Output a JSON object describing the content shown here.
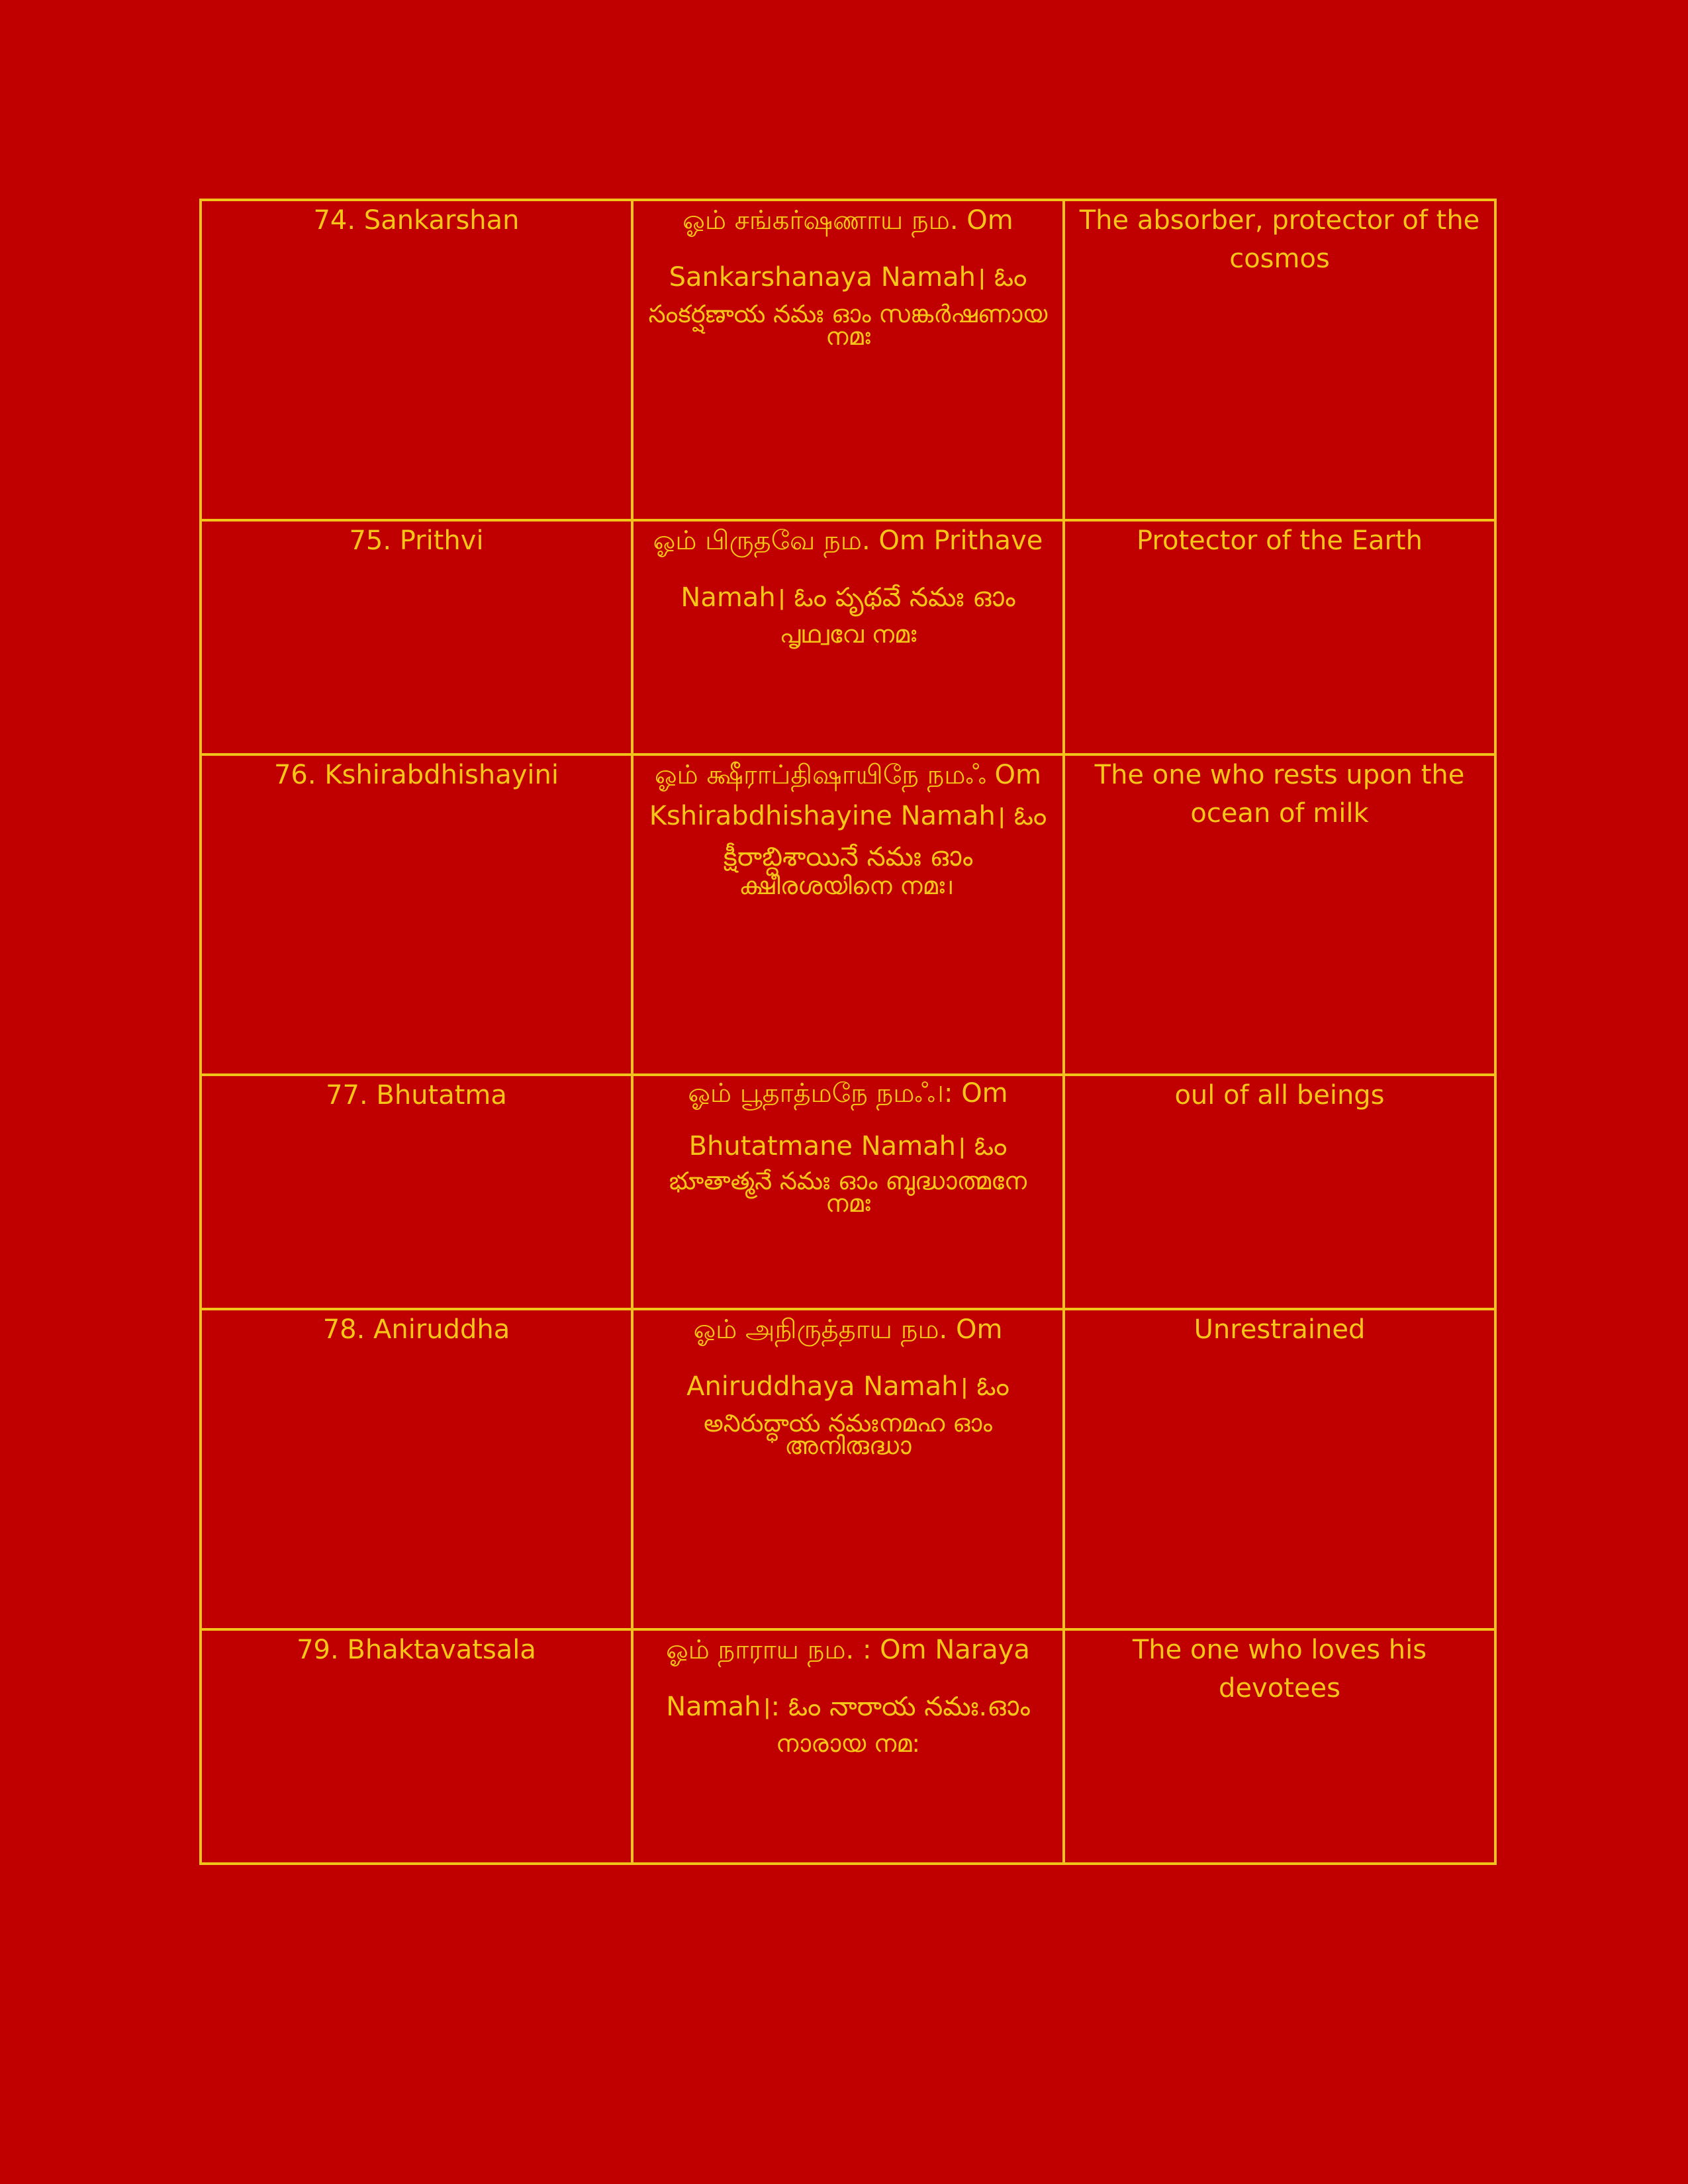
{
  "page": {
    "background_color": "#c00000",
    "text_color": "#f5c518",
    "border_color": "#f0c419"
  },
  "rows": [
    {
      "name": "74. Sankarshan",
      "mantra_head": "ஓம் சங்கர்ஷணாய நம.  Om Sankarshanaya Namah।  ఓం",
      "mantra_tail": "సంకర్షణాయ నమః ഓം സങ്കർഷണായ നമഃ",
      "meaning": "The absorber, protector of the cosmos"
    },
    {
      "name": "75. Prithvi",
      "mantra_head": "ஓம் பிருதவே நம.  Om Prithave Namah।  ఓం పృథవే నమః ഓം",
      "mantra_tail": "പൃഥ്വവേ നമഃ",
      "meaning": "Protector of the Earth"
    },
    {
      "name": "76. Kshirabdhishayini",
      "mantra_head": "ஓம் க்ஷீராப்திஷாயிநே நமஃ Om Kshirabdhishayine Namah। ఓం క్షీరాబ్ధిశాయినే నమః ഓം",
      "mantra_tail": "ക്ഷീരശയിനെ നമഃ।",
      "meaning": "The one who rests upon the ocean of milk"
    },
    {
      "name": "77. Bhutatma",
      "mantra_head": "ஓம் பூதாத்மநே நமஃ।: Om Bhutatmane Namah। ఓం",
      "mantra_tail": "భూతాత్మనే నమః ഓം ബുദ്ധാത്മനേ നമഃ",
      "meaning": "oul of all beings"
    },
    {
      "name": "78. Aniruddha",
      "mantra_head": "ஓம் அநிருத்தாய நம.  Om Aniruddhaya Namah। ఓం",
      "mantra_tail": "అనిరుద్ధాయ నమఃനമഹ ഓം അനിരുദ്ധാ",
      "meaning": "Unrestrained"
    },
    {
      "name": "79. Bhaktavatsala",
      "mantra_head": "ஓம் நாராய நம. : Om Naraya Namah।: ఓం నారాయ నమః.ഓം",
      "mantra_tail": "നാരായ നമ:",
      "meaning": "The one who loves his devotees"
    }
  ]
}
